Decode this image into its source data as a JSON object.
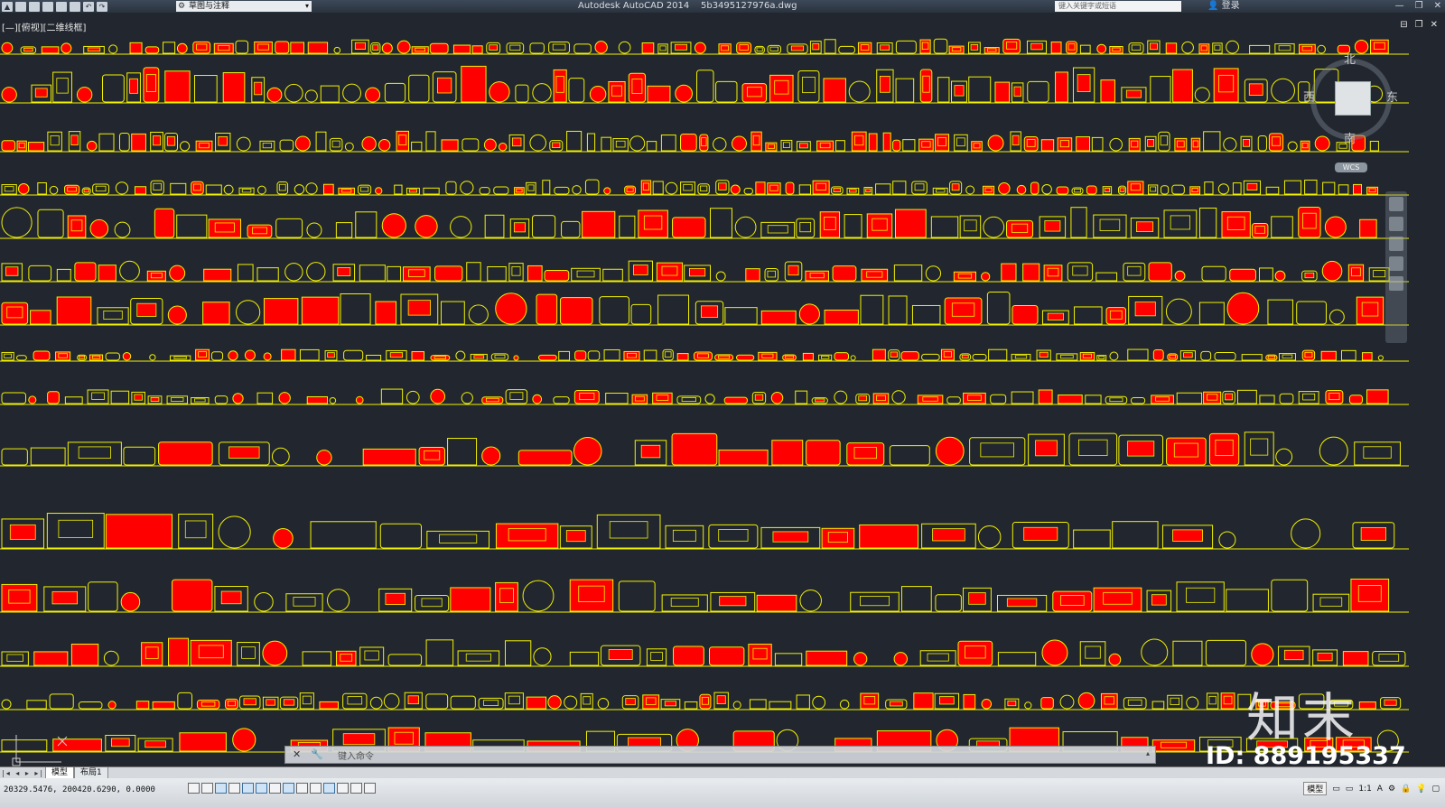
{
  "titlebar": {
    "quick_access": [
      "new",
      "open",
      "save",
      "saveas",
      "print",
      "undo",
      "redo"
    ],
    "workspace_label": "草图与注释",
    "app_title": "Autodesk AutoCAD 2014    5b3495127976a.dwg",
    "search_placeholder": "键入关键字或短语",
    "login_label": "登录",
    "window_controls": [
      "—",
      "❐",
      "✕"
    ]
  },
  "viewport": {
    "label": "[—][俯视][二维线框]",
    "controls": [
      "⊟",
      "❐",
      "✕"
    ]
  },
  "viewcube": {
    "north": "北",
    "south": "南",
    "east": "东",
    "west": "西",
    "wcs": "WCS"
  },
  "drawing": {
    "background": "#21262f",
    "line_color": "#f2f200",
    "fill_color": "#ff0000",
    "rows": 16
  },
  "command_line": {
    "placeholder": "键入命令"
  },
  "watermark": {
    "brand": "知末",
    "id_text": "ID: 889195337"
  },
  "tabs": {
    "nav": "|◂ ◂ ▸ ▸|",
    "model": "模型",
    "layout1": "布局1"
  },
  "statusbar": {
    "coordinates": "20329.5476, 200420.6290, 0.0000",
    "mode_label": "模型",
    "scale_label": "1:1"
  }
}
